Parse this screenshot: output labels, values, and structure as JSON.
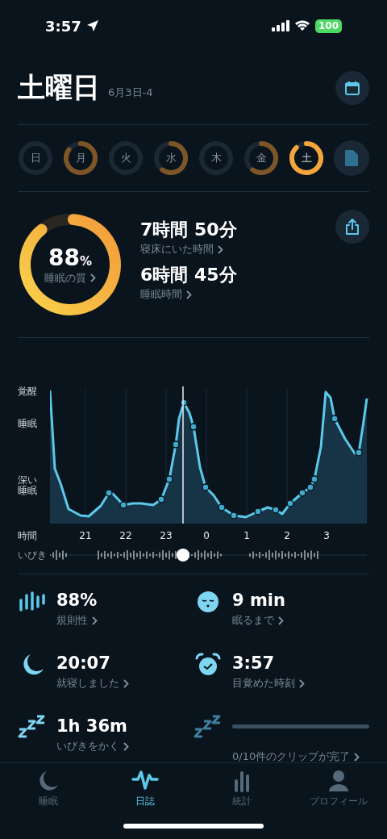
{
  "status_bar": {
    "time": "3:57",
    "battery": "100"
  },
  "header": {
    "title": "土曜日",
    "date": "6月3日-4"
  },
  "days": [
    {
      "label": "日",
      "selected": false
    },
    {
      "label": "月",
      "selected": false
    },
    {
      "label": "火",
      "selected": false
    },
    {
      "label": "水",
      "selected": false
    },
    {
      "label": "木",
      "selected": false
    },
    {
      "label": "金",
      "selected": false
    },
    {
      "label": "土",
      "selected": true
    }
  ],
  "quality": {
    "value": "88",
    "unit": "%",
    "label": "睡眠の質"
  },
  "durations": [
    {
      "value": "7時間 50分",
      "label": "寝床にいた時間"
    },
    {
      "value": "6時間 45分",
      "label": "睡眠時間"
    }
  ],
  "chart": {
    "y_labels": [
      "覚醒",
      "睡眠",
      "深い睡眠"
    ],
    "x_title": "時間",
    "x_labels": [
      "21",
      "22",
      "23",
      "0",
      "1",
      "2",
      "3"
    ],
    "snore_label": "いびき"
  },
  "stats": [
    {
      "kind": "metric",
      "value": "88%",
      "label": "規則性"
    },
    {
      "kind": "metric",
      "value": "9 min",
      "label": "眠るまで"
    },
    {
      "kind": "metric",
      "value": "20:07",
      "label": "就寝しました"
    },
    {
      "kind": "metric",
      "value": "3:57",
      "label": "目覚めた時刻"
    },
    {
      "kind": "metric",
      "value": "1h 36m",
      "label": "いびきをかく"
    },
    {
      "kind": "progress",
      "level": 0,
      "label": "0/10件のクリップが完了"
    }
  ],
  "tabs": [
    {
      "label": "睡眠",
      "selected": false
    },
    {
      "label": "日誌",
      "selected": true
    },
    {
      "label": "統計",
      "selected": false
    },
    {
      "label": "プロフィール",
      "selected": false
    }
  ]
}
